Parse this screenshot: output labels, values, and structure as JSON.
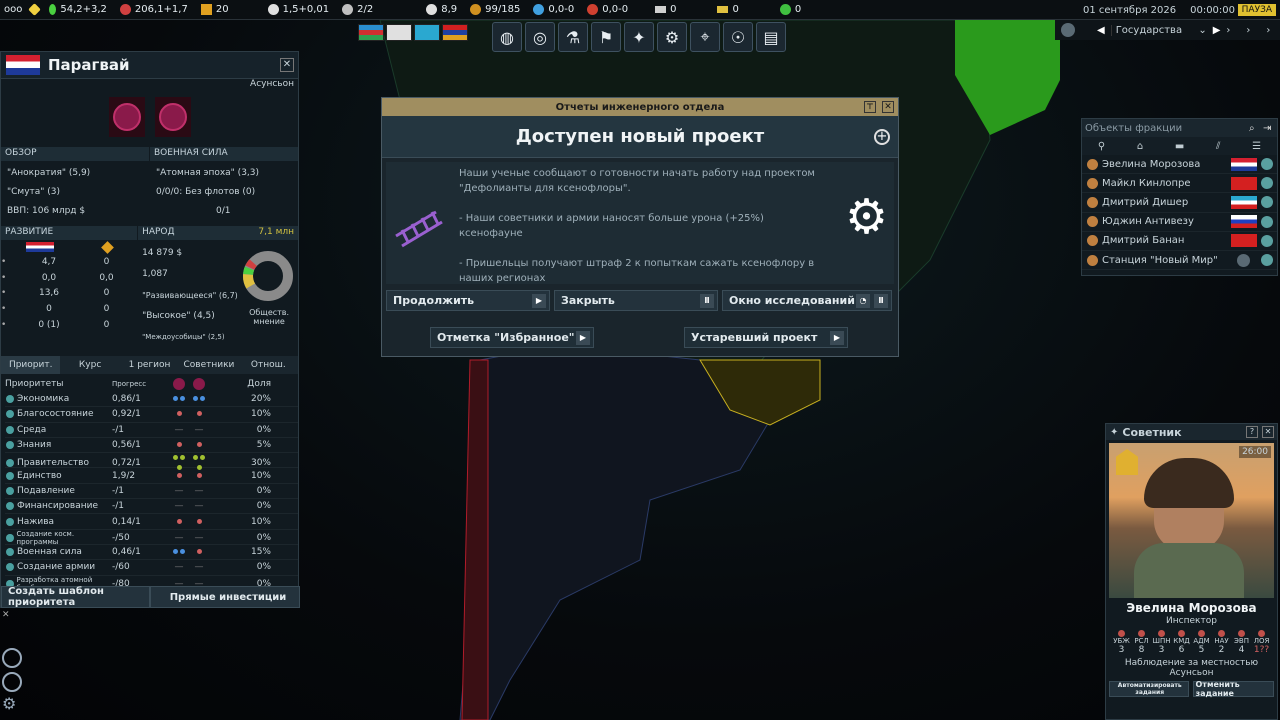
{
  "topbar": {
    "menu": "ooo",
    "funds": "54,2+3,2",
    "influence": "206,1+1,7",
    "ops": "20",
    "boost": "1,5+0,01",
    "mc": "2/2",
    "research": "8,9",
    "cp": "99/185",
    "water": "0,0-0",
    "volatiles": "0,0-0",
    "metals": "0",
    "nobles": "0",
    "fissiles": "0"
  },
  "date": {
    "date": "01 сентября 2026",
    "time": "00:00:00",
    "pause": "ПАУЗА"
  },
  "controls": {
    "view": "Государства"
  },
  "nation": {
    "name": "Парагвай",
    "capital": "Асунсьон",
    "overview_label": "ОБЗОР",
    "military_label": "ВОЕННАЯ СИЛА",
    "overview": [
      "\"Анократия\" (5,9)",
      "\"Смута\" (3)",
      "ВВП: 106 млрд $"
    ],
    "military": [
      "\"Атомная эпоха\" (3,3)",
      "0/0/0: Без флотов (0)",
      "0/1"
    ],
    "dev_label": "РАЗВИТИЕ",
    "people_label": "НАРОД",
    "pop": "7,1 млн",
    "dev_rows": [
      [
        "4,7",
        "0"
      ],
      [
        "0,0",
        "0,0"
      ],
      [
        "13,6",
        "0"
      ],
      [
        "0",
        "0"
      ],
      [
        "0 (1)",
        "0"
      ]
    ],
    "people": [
      "14 879 $",
      "1,087",
      "\"Развивающееся\" (6,7)",
      "\"Высокое\" (4,5)",
      "\"Междоусобицы\" (2,5)"
    ],
    "opinion": "Обществ. мнение",
    "tabs": [
      "Приорит.",
      "Курс",
      "1 регион",
      "Советники",
      "Отнош."
    ],
    "prio_head": [
      "Приоритеты",
      "Прогресс",
      "Доля"
    ],
    "prios": [
      [
        "Экономика",
        "0,86/1",
        "20%"
      ],
      [
        "Благосостояние",
        "0,92/1",
        "10%"
      ],
      [
        "Среда",
        "-/1",
        "0%"
      ],
      [
        "Знания",
        "0,56/1",
        "5%"
      ],
      [
        "Правительство",
        "0,72/1",
        "30%"
      ],
      [
        "Единство",
        "1,9/2",
        "10%"
      ],
      [
        "Подавление",
        "-/1",
        "0%"
      ],
      [
        "Финансирование",
        "-/1",
        "0%"
      ],
      [
        "Нажива",
        "0,14/1",
        "10%"
      ],
      [
        "Создание косм. программы",
        "-/50",
        "0%"
      ],
      [
        "Военная сила",
        "0,46/1",
        "15%"
      ],
      [
        "Создание армии",
        "-/60",
        "0%"
      ],
      [
        "Разработка атомной бомбы",
        "-/80",
        "0%"
      ]
    ],
    "btn_template": "Создать шаблон приоритета",
    "btn_invest": "Прямые инвестиции"
  },
  "dialog": {
    "title": "Отчеты инженерного отдела",
    "heading": "Доступен новый проект",
    "p1": "Наши ученые сообщают о готовности начать работу над проектом \"Дефолианты для ксенофлоры\".",
    "p2": "- Наши советники и армии наносят больше урона (+25%) ксенофауне",
    "p3": "- Пришельцы получают штраф 2 к попыткам сажать ксенофлору в наших регионах",
    "continue": "Продолжить",
    "close": "Закрыть",
    "research": "Окно исследований",
    "favorite": "Отметка \"Избранное\"",
    "obsolete": "Устаревший проект"
  },
  "faction": {
    "search": "Объекты фракции",
    "members": [
      "Эвелина Морозова",
      "Майкл Кинлопре",
      "Дмитрий Дишер",
      "Юджин Антивезу",
      "Дмитрий Банан",
      "Станция \"Новый Мир\""
    ]
  },
  "advisor": {
    "title": "Советник",
    "timer": "26:00",
    "name": "Эвелина Морозова",
    "role": "Инспектор",
    "stats_labels": [
      "УБЖ",
      "РСЛ",
      "ШПН",
      "КМД",
      "АДМ",
      "НАУ",
      "ЭВП",
      "ЛОЯ"
    ],
    "stats_values": [
      "3",
      "8",
      "3",
      "6",
      "5",
      "2",
      "4",
      "1??"
    ],
    "mission": "Наблюдение за местностью",
    "location": "Асунсьон",
    "auto": "Автоматизировать задания",
    "cancel": "Отменить задание"
  }
}
